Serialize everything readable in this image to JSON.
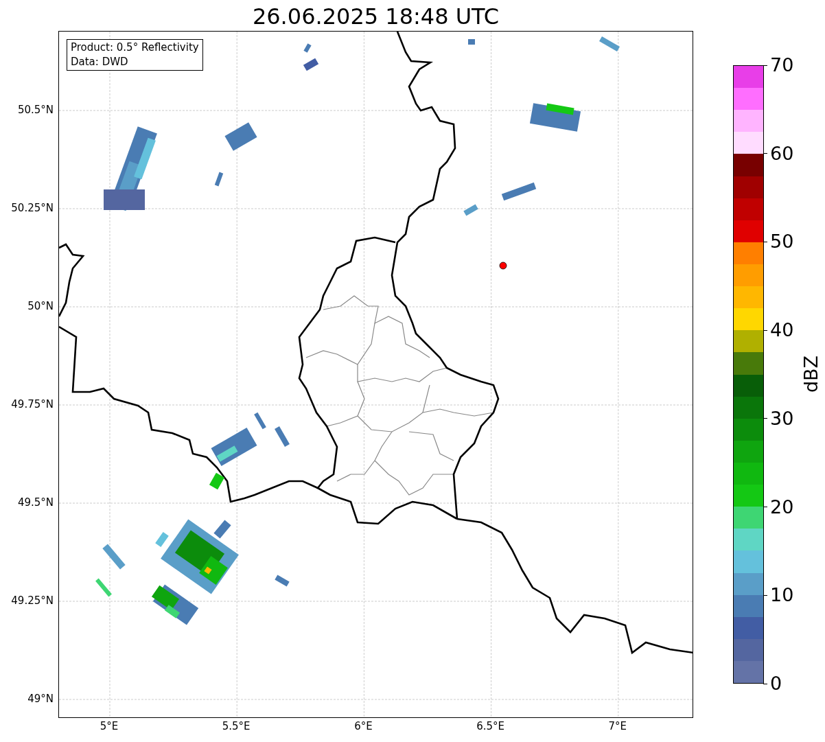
{
  "title": "26.06.2025 18:48 UTC",
  "map": {
    "info_box": [
      "Product: 0.5° Reflectivity",
      "Data: DWD"
    ],
    "xticks": [
      "5°E",
      "5.5°E",
      "6°E",
      "6.5°E",
      "7°E"
    ],
    "yticks": [
      "50.5°N",
      "50.25°N",
      "50°N",
      "49.75°N",
      "49.5°N",
      "49.25°N",
      "49°N"
    ],
    "station": {
      "color": "#ff0000"
    }
  },
  "colorbar": {
    "label": "dBZ",
    "ticks": [
      "70",
      "60",
      "50",
      "40",
      "30",
      "20",
      "10",
      "0"
    ],
    "bins": [
      {
        "color": "#e83ee8"
      },
      {
        "color": "#ff6eff"
      },
      {
        "color": "#ffb4ff"
      },
      {
        "color": "#ffdcff"
      },
      {
        "color": "#780000"
      },
      {
        "color": "#a00000"
      },
      {
        "color": "#c00000"
      },
      {
        "color": "#e00000"
      },
      {
        "color": "#ff7f00"
      },
      {
        "color": "#ff9d00"
      },
      {
        "color": "#ffb700"
      },
      {
        "color": "#ffd700"
      },
      {
        "color": "#b0b000"
      },
      {
        "color": "#487a0a"
      },
      {
        "color": "#085e08"
      },
      {
        "color": "#0a760a"
      },
      {
        "color": "#0c8c0c"
      },
      {
        "color": "#0fa50f"
      },
      {
        "color": "#10b810"
      },
      {
        "color": "#14c814"
      },
      {
        "color": "#3ed673"
      },
      {
        "color": "#5fd6c4"
      },
      {
        "color": "#64c1dc"
      },
      {
        "color": "#5a9ec8"
      },
      {
        "color": "#4a7cb3"
      },
      {
        "color": "#425da4"
      },
      {
        "color": "#5466a0"
      },
      {
        "color": "#6473a7"
      }
    ]
  }
}
